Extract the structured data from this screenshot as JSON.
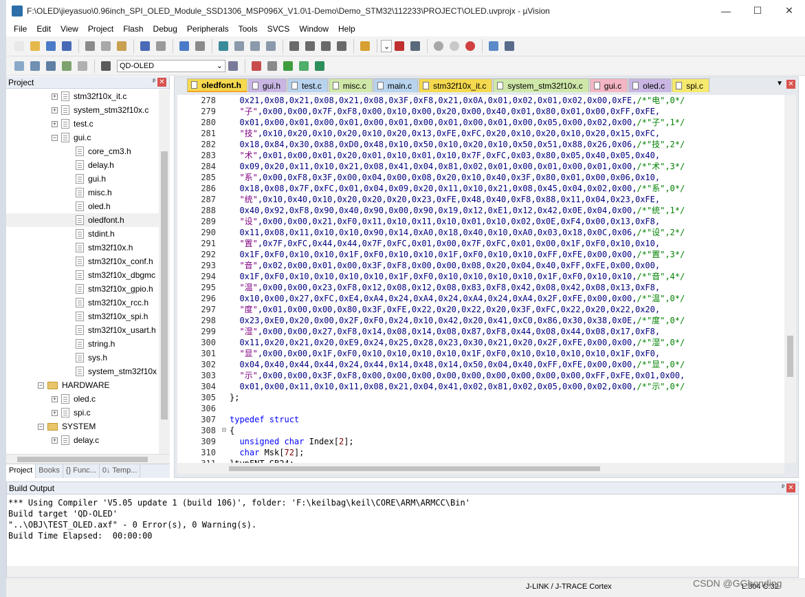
{
  "window": {
    "title": "F:\\OLED\\jieyasuo\\0.96inch_SPI_OLED_Module_SSD1306_MSP096X_V1.0\\1-Demo\\Demo_STM32\\112233\\PROJECT\\OLED.uvprojx - µVision",
    "minimize": "—",
    "maximize": "☐",
    "close": "✕"
  },
  "menu": [
    "File",
    "Edit",
    "View",
    "Project",
    "Flash",
    "Debug",
    "Peripherals",
    "Tools",
    "SVCS",
    "Window",
    "Help"
  ],
  "toolbar": {
    "target": "QD-OLED",
    "dropdown_arrow": "⌄",
    "icons": [
      "new-file-icon",
      "open-icon",
      "save-icon",
      "save-all-icon",
      "cut-icon",
      "copy-icon",
      "paste-icon",
      "undo-icon",
      "redo-icon",
      "back-icon",
      "forward-icon",
      "bookmark-icon",
      "prev-bookmark-icon",
      "next-bookmark-icon",
      "clear-bookmarks-icon",
      "indent-icon",
      "unindent-icon",
      "comment-icon",
      "uncomment-icon",
      "find-in-files-icon",
      "search-icon",
      "debug-icon",
      "breakpoint-icon",
      "disable-breakpoint-icon",
      "kill-breakpoints-icon",
      "window-icon",
      "configure-icon"
    ]
  },
  "project_panel": {
    "title": "Project",
    "pin": "ᵖ",
    "close": "✕",
    "tree": [
      {
        "label": "stm32f10x_it.c",
        "indent": 1,
        "type": "file",
        "expand": "+"
      },
      {
        "label": "system_stm32f10x.c",
        "indent": 1,
        "type": "file",
        "expand": "+"
      },
      {
        "label": "test.c",
        "indent": 1,
        "type": "file",
        "expand": "+"
      },
      {
        "label": "gui.c",
        "indent": 1,
        "type": "file",
        "expand": "−"
      },
      {
        "label": "core_cm3.h",
        "indent": 2,
        "type": "file",
        "expand": ""
      },
      {
        "label": "delay.h",
        "indent": 2,
        "type": "file",
        "expand": ""
      },
      {
        "label": "gui.h",
        "indent": 2,
        "type": "file",
        "expand": ""
      },
      {
        "label": "misc.h",
        "indent": 2,
        "type": "file",
        "expand": ""
      },
      {
        "label": "oled.h",
        "indent": 2,
        "type": "file",
        "expand": ""
      },
      {
        "label": "oledfont.h",
        "indent": 2,
        "type": "file",
        "expand": "",
        "selected": true
      },
      {
        "label": "stdint.h",
        "indent": 2,
        "type": "file",
        "expand": ""
      },
      {
        "label": "stm32f10x.h",
        "indent": 2,
        "type": "file",
        "expand": ""
      },
      {
        "label": "stm32f10x_conf.h",
        "indent": 2,
        "type": "file",
        "expand": ""
      },
      {
        "label": "stm32f10x_dbgmc",
        "indent": 2,
        "type": "file",
        "expand": ""
      },
      {
        "label": "stm32f10x_gpio.h",
        "indent": 2,
        "type": "file",
        "expand": ""
      },
      {
        "label": "stm32f10x_rcc.h",
        "indent": 2,
        "type": "file",
        "expand": ""
      },
      {
        "label": "stm32f10x_spi.h",
        "indent": 2,
        "type": "file",
        "expand": ""
      },
      {
        "label": "stm32f10x_usart.h",
        "indent": 2,
        "type": "file",
        "expand": ""
      },
      {
        "label": "string.h",
        "indent": 2,
        "type": "file",
        "expand": ""
      },
      {
        "label": "sys.h",
        "indent": 2,
        "type": "file",
        "expand": ""
      },
      {
        "label": "system_stm32f10x",
        "indent": 2,
        "type": "file",
        "expand": ""
      },
      {
        "label": "HARDWARE",
        "indent": 0,
        "type": "folder",
        "expand": "−"
      },
      {
        "label": "oled.c",
        "indent": 1,
        "type": "file",
        "expand": "+"
      },
      {
        "label": "spi.c",
        "indent": 1,
        "type": "file",
        "expand": "+"
      },
      {
        "label": "SYSTEM",
        "indent": 0,
        "type": "folder",
        "expand": "−"
      },
      {
        "label": "delay.c",
        "indent": 1,
        "type": "file",
        "expand": "+"
      }
    ],
    "tabs": [
      {
        "label": "Project",
        "active": true
      },
      {
        "label": "Books",
        "active": false
      },
      {
        "label": "{} Func...",
        "active": false
      },
      {
        "label": "0↓ Temp...",
        "active": false
      }
    ]
  },
  "editor": {
    "tabs": [
      {
        "label": "oledfont.h",
        "color": "#f5d94e",
        "active": true
      },
      {
        "label": "gui.h",
        "color": "#c9b6e4",
        "active": false
      },
      {
        "label": "test.c",
        "color": "#b7d3ee",
        "active": false
      },
      {
        "label": "misc.c",
        "color": "#cfe8a9",
        "active": false
      },
      {
        "label": "main.c",
        "color": "#b7d3ee",
        "active": false
      },
      {
        "label": "stm32f10x_it.c",
        "color": "#f5d94e",
        "active": false
      },
      {
        "label": "system_stm32f10x.c",
        "color": "#cfe8a9",
        "active": false
      },
      {
        "label": "gui.c",
        "color": "#f4b6c4",
        "active": false
      },
      {
        "label": "oled.c",
        "color": "#c9b6e4",
        "active": false
      },
      {
        "label": "spi.c",
        "color": "#f5e96e",
        "active": false
      }
    ],
    "tab_menu": "▼",
    "tab_close": "✕",
    "lines": [
      {
        "num": "278",
        "fold": "",
        "hex": "  0x21,0x08,0x21,0x08,0x21,0x08,0x3F,0xF8,0x21,0x0A,0x01,0x02,0x01,0x02,0x00,0xFE,",
        "cmt": "/*\"电\",0*/"
      },
      {
        "num": "279",
        "fold": "",
        "str": "  \"子\"",
        "hex": ",0x00,0x00,0x7F,0xF8,0x00,0x10,0x00,0x20,0x00,0x40,0x01,0x80,0x01,0x00,0xFF,0xFE,"
      },
      {
        "num": "280",
        "fold": "",
        "hex": "  0x01,0x00,0x01,0x00,0x01,0x00,0x01,0x00,0x01,0x00,0x01,0x00,0x05,0x00,0x02,0x00,",
        "cmt": "/*\"子\",1*/"
      },
      {
        "num": "281",
        "fold": "",
        "str": "  \"技\"",
        "hex": ",0x10,0x20,0x10,0x20,0x10,0x20,0x13,0xFE,0xFC,0x20,0x10,0x20,0x10,0x20,0x15,0xFC,"
      },
      {
        "num": "282",
        "fold": "",
        "hex": "  0x18,0x84,0x30,0x88,0xD0,0x48,0x10,0x50,0x10,0x20,0x10,0x50,0x51,0x88,0x26,0x06,",
        "cmt": "/*\"技\",2*/"
      },
      {
        "num": "283",
        "fold": "",
        "str": "  \"术\"",
        "hex": ",0x01,0x00,0x01,0x20,0x01,0x10,0x01,0x10,0x7F,0xFC,0x03,0x80,0x05,0x40,0x05,0x40,"
      },
      {
        "num": "284",
        "fold": "",
        "hex": "  0x09,0x20,0x11,0x10,0x21,0x08,0x41,0x04,0x81,0x02,0x01,0x00,0x01,0x00,0x01,0x00,",
        "cmt": "/*\"术\",3*/"
      },
      {
        "num": "285",
        "fold": "",
        "str": "  \"系\"",
        "hex": ",0x00,0xF8,0x3F,0x00,0x04,0x00,0x08,0x20,0x10,0x40,0x3F,0x80,0x01,0x00,0x06,0x10,"
      },
      {
        "num": "286",
        "fold": "",
        "hex": "  0x18,0x08,0x7F,0xFC,0x01,0x04,0x09,0x20,0x11,0x10,0x21,0x08,0x45,0x04,0x02,0x00,",
        "cmt": "/*\"系\",0*/"
      },
      {
        "num": "287",
        "fold": "",
        "str": "  \"统\"",
        "hex": ",0x10,0x40,0x10,0x20,0x20,0x20,0x23,0xFE,0x48,0x40,0xF8,0x88,0x11,0x04,0x23,0xFE,"
      },
      {
        "num": "288",
        "fold": "",
        "hex": "  0x40,0x92,0xF8,0x90,0x40,0x90,0x00,0x90,0x19,0x12,0xE1,0x12,0x42,0x0E,0x04,0x00,",
        "cmt": "/*\"统\",1*/"
      },
      {
        "num": "289",
        "fold": "",
        "str": "  \"设\"",
        "hex": ",0x00,0x00,0x21,0xF0,0x11,0x10,0x11,0x10,0x01,0x10,0x02,0x0E,0xF4,0x00,0x13,0xF8,"
      },
      {
        "num": "290",
        "fold": "",
        "hex": "  0x11,0x08,0x11,0x10,0x10,0x90,0x14,0xA0,0x18,0x40,0x10,0xA0,0x03,0x18,0x0C,0x06,",
        "cmt": "/*\"设\",2*/"
      },
      {
        "num": "291",
        "fold": "",
        "str": "  \"置\"",
        "hex": ",0x7F,0xFC,0x44,0x44,0x7F,0xFC,0x01,0x00,0x7F,0xFC,0x01,0x00,0x1F,0xF0,0x10,0x10,"
      },
      {
        "num": "292",
        "fold": "",
        "hex": "  0x1F,0xF0,0x10,0x10,0x1F,0xF0,0x10,0x10,0x1F,0xF0,0x10,0x10,0xFF,0xFE,0x00,0x00,",
        "cmt": "/*\"置\",3*/"
      },
      {
        "num": "293",
        "fold": "",
        "str": "  \"音\"",
        "hex": ",0x02,0x00,0x01,0x00,0x3F,0xF8,0x00,0x00,0x08,0x20,0x04,0x40,0xFF,0xFE,0x00,0x00,"
      },
      {
        "num": "294",
        "fold": "",
        "hex": "  0x1F,0xF0,0x10,0x10,0x10,0x10,0x1F,0xF0,0x10,0x10,0x10,0x10,0x1F,0xF0,0x10,0x10,",
        "cmt": "/*\"音\",4*/"
      },
      {
        "num": "295",
        "fold": "",
        "str": "  \"温\"",
        "hex": ",0x00,0x00,0x23,0xF8,0x12,0x08,0x12,0x08,0x83,0xF8,0x42,0x08,0x42,0x08,0x13,0xF8,"
      },
      {
        "num": "296",
        "fold": "",
        "hex": "  0x10,0x00,0x27,0xFC,0xE4,0xA4,0x24,0xA4,0x24,0xA4,0x24,0xA4,0x2F,0xFE,0x00,0x00,",
        "cmt": "/*\"温\",0*/"
      },
      {
        "num": "297",
        "fold": "",
        "str": "  \"度\"",
        "hex": ",0x01,0x00,0x00,0x80,0x3F,0xFE,0x22,0x20,0x22,0x20,0x3F,0xFC,0x22,0x20,0x22,0x20,"
      },
      {
        "num": "298",
        "fold": "",
        "hex": "  0x23,0xE0,0x20,0x00,0x2F,0xF0,0x24,0x10,0x42,0x20,0x41,0xC0,0x86,0x30,0x38,0x0E,",
        "cmt": "/*\"度\",0*/"
      },
      {
        "num": "299",
        "fold": "",
        "str": "  \"湿\"",
        "hex": ",0x00,0x00,0x27,0xF8,0x14,0x08,0x14,0x08,0x87,0xF8,0x44,0x08,0x44,0x08,0x17,0xF8,"
      },
      {
        "num": "300",
        "fold": "",
        "hex": "  0x11,0x20,0x21,0x20,0xE9,0x24,0x25,0x28,0x23,0x30,0x21,0x20,0x2F,0xFE,0x00,0x00,",
        "cmt": "/*\"湿\",0*/"
      },
      {
        "num": "301",
        "fold": "",
        "str": "  \"显\"",
        "hex": ",0x00,0x00,0x1F,0xF0,0x10,0x10,0x10,0x10,0x1F,0xF0,0x10,0x10,0x10,0x10,0x1F,0xF0,"
      },
      {
        "num": "302",
        "fold": "",
        "hex": "  0x04,0x40,0x44,0x44,0x24,0x44,0x14,0x48,0x14,0x50,0x04,0x40,0xFF,0xFE,0x00,0x00,",
        "cmt": "/*\"显\",0*/"
      },
      {
        "num": "303",
        "fold": "",
        "str": "  \"示\"",
        "hex": ",0x00,0x00,0x3F,0xF8,0x00,0x00,0x00,0x00,0x00,0x00,0x00,0x00,0x00,0xFF,0xFE,0x01,0x00,"
      },
      {
        "num": "304",
        "fold": "",
        "hex": "  0x01,0x00,0x11,0x10,0x11,0x08,0x21,0x04,0x41,0x02,0x81,0x02,0x05,0x00,0x02,0x00,",
        "cmt": "/*\"示\",0*/"
      },
      {
        "num": "305",
        "fold": "",
        "plain": "};"
      },
      {
        "num": "306",
        "fold": "",
        "plain": ""
      },
      {
        "num": "307",
        "fold": "",
        "kw": "typedef struct",
        "plain": ""
      },
      {
        "num": "308",
        "fold": "⊟",
        "plain": "{"
      },
      {
        "num": "309",
        "fold": "",
        "kw": "  unsigned char",
        "plain": " Index[",
        "num2": "2",
        "tail": "];"
      },
      {
        "num": "310",
        "fold": "",
        "kw": "  char",
        "plain": " Msk[",
        "num2": "72",
        "tail": "];"
      },
      {
        "num": "311",
        "fold": "",
        "plain": "}typFNT_GB24;"
      }
    ]
  },
  "build_output": {
    "title": "Build Output",
    "pin": "ᵖ",
    "close": "✕",
    "lines": [
      "*** Using Compiler 'V5.05 update 1 (build 106)', folder: 'F:\\keilbag\\keil\\CORE\\ARM\\ARMCC\\Bin'",
      "Build target 'QD-OLED'",
      "\"..\\OBJ\\TEST_OLED.axf\" - 0 Error(s), 0 Warning(s).",
      "Build Time Elapsed:  00:00:00"
    ]
  },
  "statusbar": {
    "debugger": "J-LINK / J-TRACE Cortex",
    "position": "L:304 C:32"
  },
  "watermark": "CSDN @GGbonding"
}
